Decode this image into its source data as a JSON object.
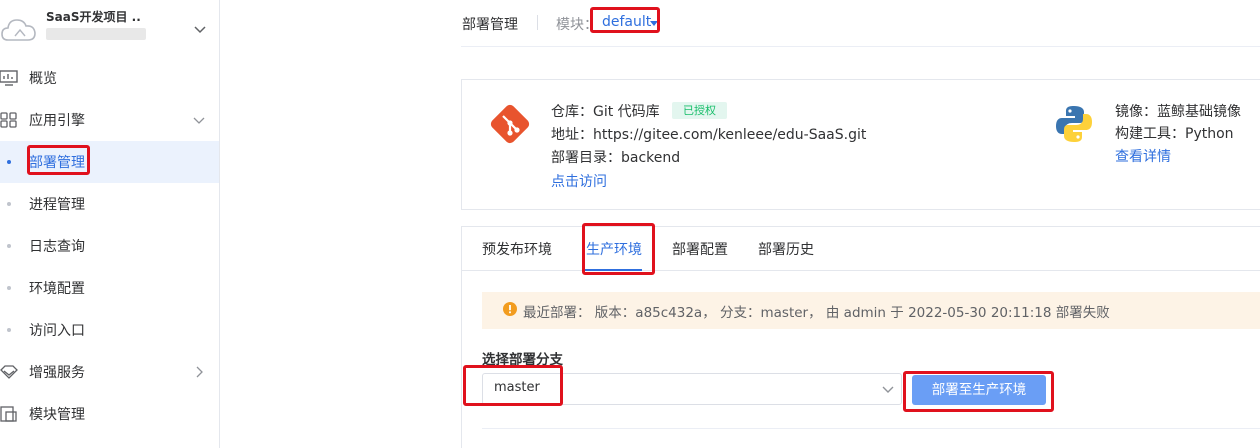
{
  "sidebar": {
    "project_name": "SaaS开发项目 ..",
    "nav": [
      {
        "label": "概览"
      },
      {
        "label": "应用引擎"
      },
      {
        "label": "增强服务"
      },
      {
        "label": "模块管理"
      }
    ],
    "sub_items": [
      {
        "label": "部署管理",
        "active": true
      },
      {
        "label": "进程管理"
      },
      {
        "label": "日志查询"
      },
      {
        "label": "环境配置"
      },
      {
        "label": "访问入口"
      }
    ]
  },
  "header": {
    "title": "部署管理",
    "module_label": "模块：",
    "module_value": "default"
  },
  "repo": {
    "repo_line": "仓库：Git 代码库",
    "auth_badge": "已授权",
    "address_line": "地址：https://gitee.com/kenleee/edu-SaaS.git",
    "dir_line": "部署目录：backend",
    "visit_link": "点击访问",
    "image_line": "镜像：蓝鲸基础镜像",
    "build_line": "构建工具：Python",
    "details_link": "查看详情"
  },
  "tabs": [
    {
      "label": "预发布环境"
    },
    {
      "label": "生产环境",
      "active": true
    },
    {
      "label": "部署配置"
    },
    {
      "label": "部署历史"
    }
  ],
  "alert": {
    "text": "最近部署： 版本：a85c432a， 分支：master， 由 admin 于 2022-05-30 20:11:18 部署失败"
  },
  "branch": {
    "label": "选择部署分支",
    "value": "master",
    "deploy_button": "部署至生产环境"
  },
  "colors": {
    "accent": "#2f6fde",
    "button": "#6a9ef5",
    "annotation": "#e0111d",
    "warning_bg": "#fdf3e6",
    "badge": "#19be6b"
  }
}
